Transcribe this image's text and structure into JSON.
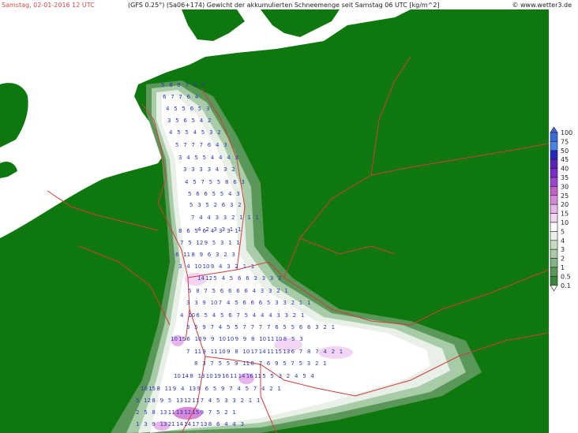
{
  "header": {
    "date_time": "Samstag, 02-01-2016  12 UTC",
    "model_desc": "(GFS 0.25°) (Sa06+174)  Gewicht der akkumulierten Schneemenge seit Samstag 06 UTC [kg/m^2]",
    "copyright": "© www.wetter3.de"
  },
  "colors": {
    "land": "#0e780e",
    "sea": "#ffffff",
    "borders": "#d23a3a",
    "values_text": "#2a36b8"
  },
  "legend": {
    "levels": [
      "100",
      "75",
      "50",
      "45",
      "40",
      "35",
      "30",
      "25",
      "20",
      "15",
      "10",
      "5",
      "4",
      "3",
      "2",
      "1",
      "0.5",
      "0.1"
    ],
    "colors": [
      "#3a6ad8",
      "#4a82e8",
      "#2626c0",
      "#5a22b8",
      "#7a2ac8",
      "#9a44d0",
      "#c060c8",
      "#d888d8",
      "#e8b4ec",
      "#f2d4f4",
      "#ffffff",
      "#e8f0e8",
      "#c4dcc4",
      "#a8cca8",
      "#84b484",
      "#5a985a",
      "#3a863a",
      "#ffffff"
    ]
  },
  "grid_values": [
    {
      "row": "r1",
      "vals": [
        "5",
        "8",
        "8",
        "7",
        "5",
        "4"
      ]
    },
    {
      "row": "r2",
      "vals": [
        "6",
        "7",
        "7",
        "6",
        "4"
      ]
    },
    {
      "row": "r3",
      "vals": [
        "4",
        "5",
        "5",
        "6",
        "5",
        "3"
      ]
    },
    {
      "row": "r4",
      "vals": [
        "3",
        "5",
        "6",
        "5",
        "4",
        "2"
      ]
    },
    {
      "row": "r5",
      "vals": [
        "4",
        "5",
        "5",
        "4",
        "5",
        "3",
        "2"
      ]
    },
    {
      "row": "r6",
      "vals": [
        "5",
        "7",
        "7",
        "7",
        "6",
        "4",
        "3"
      ]
    },
    {
      "row": "r7",
      "vals": [
        "3",
        "4",
        "5",
        "5",
        "4",
        "4",
        "4",
        "3"
      ]
    },
    {
      "row": "r8",
      "vals": [
        "3",
        "3",
        "3",
        "3",
        "4",
        "3",
        "2"
      ]
    },
    {
      "row": "r9",
      "vals": [
        "4",
        "5",
        "7",
        "5",
        "5",
        "8",
        "6",
        "3"
      ]
    },
    {
      "row": "r10",
      "vals": [
        "5",
        "6",
        "6",
        "5",
        "5",
        "4",
        "3"
      ]
    },
    {
      "row": "r11",
      "vals": [
        "5",
        "3",
        "5",
        "2",
        "6",
        "3",
        "2"
      ]
    },
    {
      "row": "r12",
      "vals": [
        "7",
        "4",
        "4",
        "3",
        "3",
        "2",
        "1",
        "1",
        "1"
      ]
    },
    {
      "row": "r13",
      "vals": [
        "4",
        "2",
        "3",
        "3",
        "1",
        "1"
      ]
    },
    {
      "row": "r14",
      "vals": [
        "8",
        "6",
        "5",
        "6",
        "4",
        "3",
        "3",
        "1"
      ]
    },
    {
      "row": "r15",
      "vals": [
        "7",
        "5",
        "12",
        "9",
        "5",
        "3",
        "1",
        "1"
      ]
    },
    {
      "row": "r16",
      "vals": [
        "6",
        "11",
        "8",
        "9",
        "6",
        "3",
        "2",
        "3"
      ]
    },
    {
      "row": "r17",
      "vals": [
        "3",
        "4",
        "10",
        "10",
        "9",
        "4",
        "3",
        "2",
        "1",
        "1"
      ]
    },
    {
      "row": "r18",
      "vals": [
        "14",
        "12",
        "5",
        "4",
        "5",
        "6",
        "6",
        "3",
        "3",
        "3",
        "2"
      ]
    },
    {
      "row": "r19",
      "vals": [
        "5",
        "8",
        "7",
        "5",
        "6",
        "6",
        "6",
        "6",
        "4",
        "3",
        "3",
        "2",
        "1"
      ]
    },
    {
      "row": "r20",
      "vals": [
        "3",
        "3",
        "9",
        "10",
        "7",
        "4",
        "5",
        "6",
        "6",
        "6",
        "5",
        "3",
        "3",
        "2",
        "1",
        "1"
      ]
    },
    {
      "row": "r21",
      "vals": [
        "4",
        "10",
        "6",
        "5",
        "4",
        "5",
        "6",
        "7",
        "5",
        "4",
        "4",
        "4",
        "3",
        "3",
        "2",
        "1"
      ]
    },
    {
      "row": "r22",
      "vals": [
        "3",
        "5",
        "9",
        "7",
        "4",
        "5",
        "5",
        "7",
        "7",
        "7",
        "7",
        "6",
        "5",
        "5",
        "6",
        "6",
        "3",
        "2",
        "1"
      ]
    },
    {
      "row": "r23",
      "vals": [
        "10",
        "15",
        "6",
        "10",
        "9",
        "9",
        "10",
        "10",
        "9",
        "9",
        "8",
        "10",
        "11",
        "10",
        "8",
        "5",
        "3"
      ]
    },
    {
      "row": "r24",
      "vals": [
        "7",
        "11",
        "9",
        "11",
        "10",
        "9",
        "8",
        "10",
        "17",
        "14",
        "11",
        "15",
        "13",
        "6",
        "7",
        "8",
        "7",
        "4",
        "2",
        "1"
      ]
    },
    {
      "row": "r25",
      "vals": [
        "8",
        "3",
        "7",
        "5",
        "5",
        "9",
        "11",
        "8",
        "7",
        "6",
        "9",
        "5",
        "7",
        "5",
        "3",
        "2",
        "1"
      ]
    },
    {
      "row": "r26",
      "vals": [
        "10",
        "14",
        "8",
        "13",
        "10",
        "19",
        "16",
        "11",
        "14",
        "16",
        "11",
        "5",
        "5",
        "3",
        "2",
        "4",
        "5",
        "4"
      ]
    },
    {
      "row": "r27",
      "vals": [
        "10",
        "15",
        "8",
        "11",
        "9",
        "4",
        "13",
        "9",
        "6",
        "5",
        "9",
        "7",
        "4",
        "5",
        "7",
        "4",
        "2",
        "1"
      ]
    },
    {
      "row": "r28",
      "vals": [
        "5",
        "12",
        "8",
        "9",
        "5",
        "13",
        "12",
        "11",
        "7",
        "4",
        "5",
        "3",
        "3",
        "2",
        "1",
        "1"
      ]
    },
    {
      "row": "r29",
      "vals": [
        "2",
        "5",
        "8",
        "13",
        "11",
        "13",
        "12",
        "15",
        "9",
        "7",
        "5",
        "2",
        "1"
      ]
    },
    {
      "row": "r30",
      "vals": [
        "1",
        "3",
        "9",
        "13",
        "21",
        "14",
        "14",
        "17",
        "13",
        "8",
        "6",
        "4",
        "4",
        "3"
      ]
    },
    {
      "row": "r31",
      "vals": [
        "2",
        "5",
        "3",
        "20",
        "13",
        "6",
        "2",
        "1"
      ]
    }
  ]
}
